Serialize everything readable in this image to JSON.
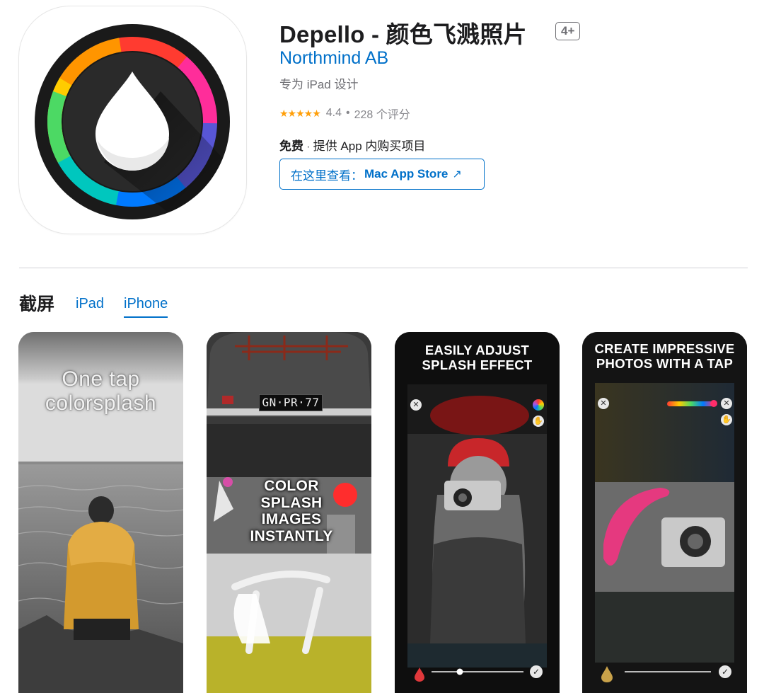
{
  "app": {
    "title": "Depello - 颜色飞溅照片",
    "age_rating": "4+",
    "developer": "Northmind AB",
    "platform": "专为 iPad 设计",
    "stars": "★★★★★",
    "rating": "4.4",
    "rating_separator": "•",
    "rating_count": "228 个评分",
    "price": "免费",
    "price_separator": "·",
    "iap_note": "提供 App 内购买项目",
    "mac_store_prefix": "在这里查看：",
    "mac_store_name": "Mac App Store",
    "mac_store_arrow": "↗"
  },
  "screenshots_section": {
    "title": "截屏",
    "tabs": [
      {
        "label": "iPad",
        "selected": false
      },
      {
        "label": "iPhone",
        "selected": true
      }
    ]
  },
  "screenshots": [
    {
      "caption": "One tap\ncolorsplash"
    },
    {
      "caption": "COLOR\nSPLASH\nIMAGES\nINSTANTLY",
      "plate_text": "GN·PR·77"
    },
    {
      "caption": "EASILY ADJUST\nSPLASH EFFECT"
    },
    {
      "caption": "CREATE IMPRESSIVE\nPHOTOS WITH A TAP"
    }
  ],
  "colors": {
    "accent": "#0070c9",
    "star": "#ff9f0a",
    "secondary_text": "#6e6e73"
  },
  "icons": {
    "app_icon": "color-wheel-droplet-icon",
    "external_link": "arrow-up-right-icon",
    "close": "close-icon",
    "color_picker": "color-wheel-icon",
    "hand": "hand-icon",
    "checkmark": "checkmark-icon",
    "drop": "droplet-icon"
  }
}
